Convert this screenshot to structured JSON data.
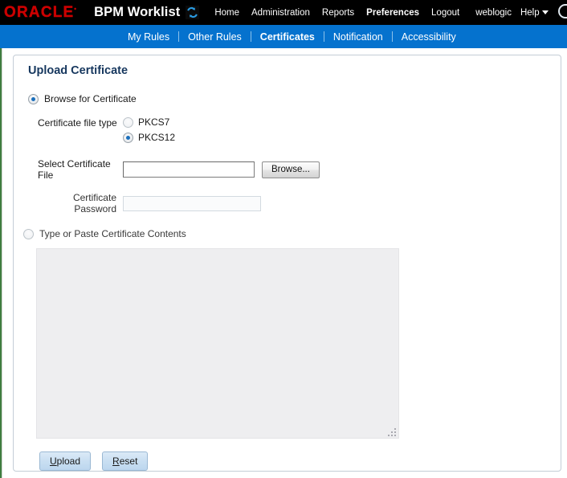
{
  "brand": {
    "logo_text": "ORACLE",
    "logo_color": "#cc0000",
    "app_title": "BPM Worklist",
    "app_icon": "sync-arrows-icon",
    "global_links": [
      {
        "label": "Home",
        "active": false
      },
      {
        "label": "Administration",
        "active": false
      },
      {
        "label": "Reports",
        "active": false
      },
      {
        "label": "Preferences",
        "active": true
      },
      {
        "label": "Logout",
        "active": false
      }
    ],
    "user_name": "weblogic",
    "help_label": "Help",
    "help_icon": "chevron-down-icon"
  },
  "nav": {
    "accent_color": "#0572ce",
    "tabs": [
      {
        "label": "My Rules",
        "active": false
      },
      {
        "label": "Other Rules",
        "active": false
      },
      {
        "label": "Certificates",
        "active": true
      },
      {
        "label": "Notification",
        "active": false
      },
      {
        "label": "Accessibility",
        "active": false
      }
    ]
  },
  "main": {
    "page_title": "Upload Certificate",
    "title_color": "#16375e",
    "source_mode": {
      "browse_option_label": "Browse for Certificate",
      "browse_option_selected": true,
      "paste_option_label": "Type or Paste Certificate Contents",
      "paste_option_selected": false
    },
    "file_type": {
      "label": "Certificate file type",
      "options": [
        {
          "label": "PKCS7",
          "selected": false
        },
        {
          "label": "PKCS12",
          "selected": true
        }
      ]
    },
    "select_file": {
      "label": "Select Certificate File",
      "value": "",
      "placeholder": "",
      "browse_label": "Browse..."
    },
    "password": {
      "label": "Certificate Password",
      "value": "",
      "placeholder": "",
      "disabled": true
    },
    "contents": {
      "value": "",
      "placeholder": "",
      "disabled": true,
      "resize_grip_icon": "resize-grip-icon"
    },
    "actions": {
      "upload": {
        "prefix": "",
        "accesskey": "U",
        "suffix": "pload"
      },
      "reset": {
        "prefix": "",
        "accesskey": "R",
        "suffix": "eset"
      }
    }
  }
}
